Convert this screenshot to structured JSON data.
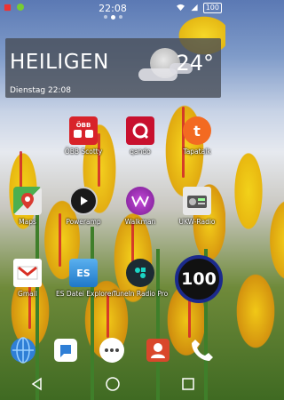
{
  "status_bar": {
    "clock": "22:08",
    "battery": "100",
    "left_icons": [
      "notification-icon",
      "android-icon"
    ],
    "right_icons": [
      "wifi-icon",
      "signal-icon",
      "battery-icon"
    ]
  },
  "page_indicator": {
    "pages": 3,
    "active": 1
  },
  "weather": {
    "city": "HEILIGEN",
    "temperature": "24°",
    "datetime": "Dienstag 22:08",
    "condition_icon": "moon-cloud-icon"
  },
  "apps": [
    {
      "label": "ÖBB Scotty",
      "icon": "oebb-scotty-icon",
      "color": "#d8232a"
    },
    {
      "label": "qando",
      "icon": "qando-icon",
      "color": "#c8102e"
    },
    {
      "label": "Tapatalk",
      "icon": "tapatalk-icon",
      "color": "#f36a21"
    },
    {
      "label": "Maps",
      "icon": "maps-icon",
      "color": "#4caf50"
    },
    {
      "label": "Poweramp",
      "icon": "poweramp-icon",
      "color": "#1a1a1a"
    },
    {
      "label": "Walkman",
      "icon": "walkman-icon",
      "color": "#8e2ba5"
    },
    {
      "label": "UKW-Radio",
      "icon": "radio-icon",
      "color": "#e8e8e8"
    },
    {
      "label": "Gmail",
      "icon": "gmail-icon",
      "color": "#ffffff"
    },
    {
      "label": "ES Datei Explorer",
      "icon": "es-explorer-icon",
      "color": "#2a8bd6"
    },
    {
      "label": "TuneIn Radio Pro",
      "icon": "tunein-icon",
      "color": "#1c2b33"
    },
    {
      "label": "100",
      "icon": "app-100-icon",
      "color": "#1b2a8c"
    }
  ],
  "dock": [
    {
      "icon": "browser-globe-icon",
      "color": "#2f7fd6"
    },
    {
      "icon": "messaging-icon",
      "color": "#ffffff"
    },
    {
      "icon": "app-drawer-icon",
      "color": "#ffffff"
    },
    {
      "icon": "contacts-icon",
      "color": "#d9472b"
    },
    {
      "icon": "phone-icon",
      "color": "#ffffff"
    }
  ],
  "nav": [
    "back-icon",
    "home-icon",
    "recents-icon"
  ]
}
